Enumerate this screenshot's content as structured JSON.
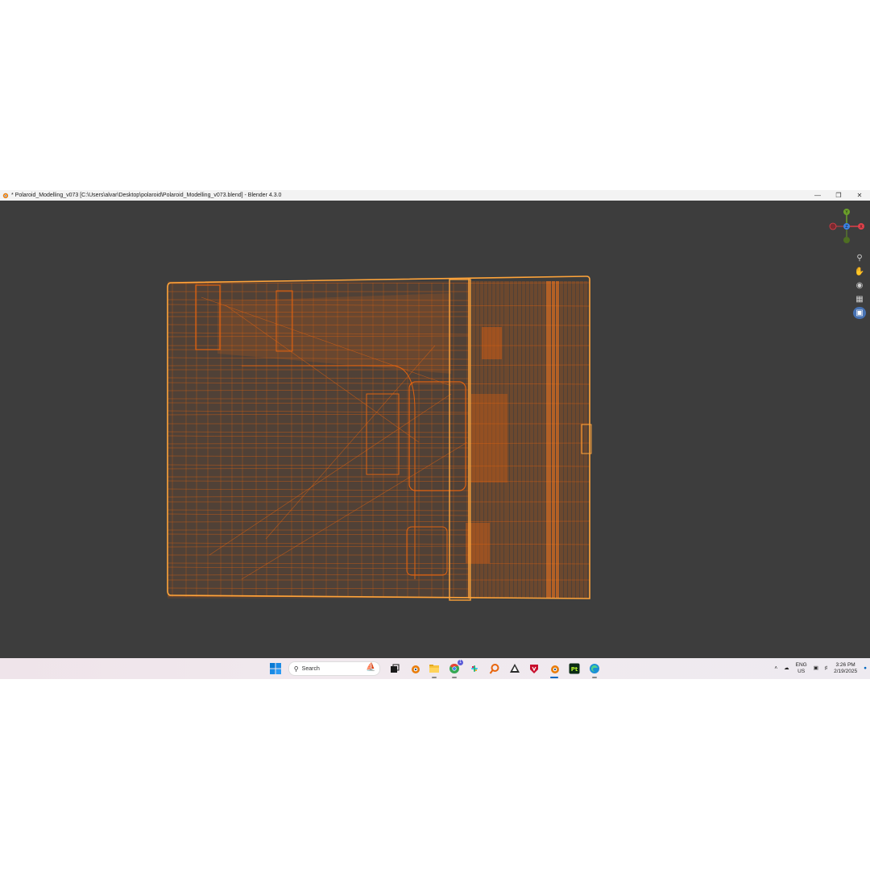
{
  "window": {
    "title": "* Polaroid_Modelling_v073 [C:\\Users\\alvar\\Desktop\\polaroid\\Polaroid_Modelling_v073.blend] - Blender 4.3.0",
    "controls": [
      "minimize-icon",
      "restore-icon",
      "close-icon"
    ]
  },
  "viewport": {
    "background": "#3d3d3d",
    "wire_color": "#e0620f",
    "selected_wire_color": "#ffa43a",
    "gizmo": {
      "x_label": "X",
      "y_label": "Y",
      "z_label": "Z"
    },
    "nav_tools": [
      "zoom-icon",
      "pan-hand-icon",
      "camera-icon",
      "grid-icon",
      "perspective-toggle-icon"
    ]
  },
  "taskbar": {
    "search_placeholder": "Search",
    "apps": [
      "start-icon",
      "search",
      "task-view-icon",
      "blender-icon",
      "file-explorer-icon",
      "chrome-icon",
      "slack-icon",
      "zbrush-icon",
      "inkscape-icon",
      "valorant-icon",
      "blender-icon",
      "substance-painter-icon",
      "edge-icon"
    ],
    "chrome_badge": "1",
    "tray": {
      "lang_top": "ENG",
      "lang_bottom": "US",
      "time": "3:26 PM",
      "date": "2/19/2025"
    }
  }
}
